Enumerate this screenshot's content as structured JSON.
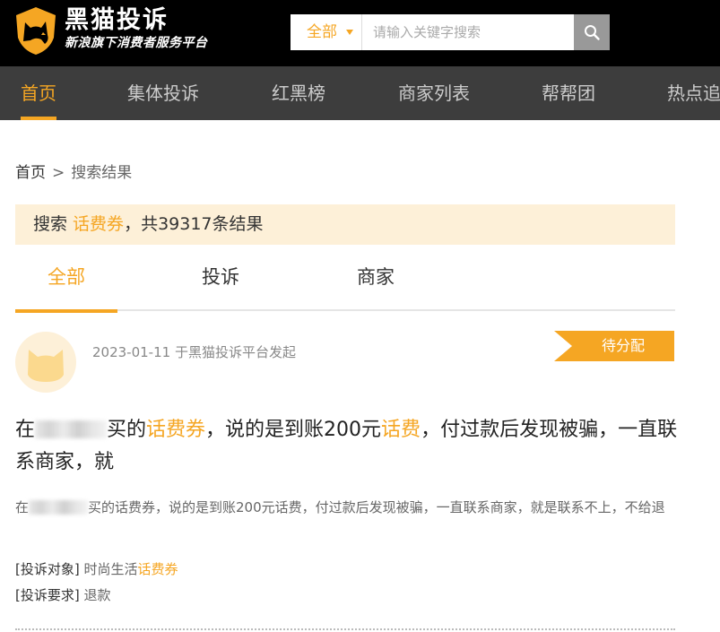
{
  "header": {
    "brand_name": "黑猫投诉",
    "brand_tagline": "新浪旗下消费者服务平台",
    "search": {
      "scope": "全部",
      "placeholder": "请输入关键字搜索",
      "value": ""
    }
  },
  "nav": {
    "items": [
      "首页",
      "集体投诉",
      "红黑榜",
      "商家列表",
      "帮帮团",
      "热点追"
    ],
    "active": "首页"
  },
  "breadcrumb": {
    "home": "首页",
    "separator": ">",
    "current": "搜索结果"
  },
  "results": {
    "prefix": "搜索 ",
    "keyword": "话费券",
    "suffix": "，共39317条结果"
  },
  "tabs": {
    "items": [
      "全部",
      "投诉",
      "商家"
    ],
    "active": "全部"
  },
  "complaint": {
    "meta": "2023-01-11 于黑猫投诉平台发起",
    "status": "待分配",
    "title": {
      "lead": "在",
      "after_blur": "买的",
      "hl1": "话费券",
      "mid": "，说的是到账200元",
      "hl2": "话费",
      "tail": "，付过款后发现被骗，一直联系商家，就"
    },
    "description": {
      "lead": "在",
      "rest": "买的话费券，说的是到账200元话费，付过款后发现被骗，一直联系商家，就是联系不上，不给退"
    },
    "target_label": "[投诉对象]",
    "target_value": "时尚生活",
    "target_hl": "话费券",
    "demand_label": "[投诉要求]",
    "demand_value": "退款"
  },
  "colors": {
    "accent": "#f5a623",
    "header_bg": "#000000",
    "nav_bg": "#3d3d3d",
    "result_bar_bg": "#fdf0d8"
  }
}
